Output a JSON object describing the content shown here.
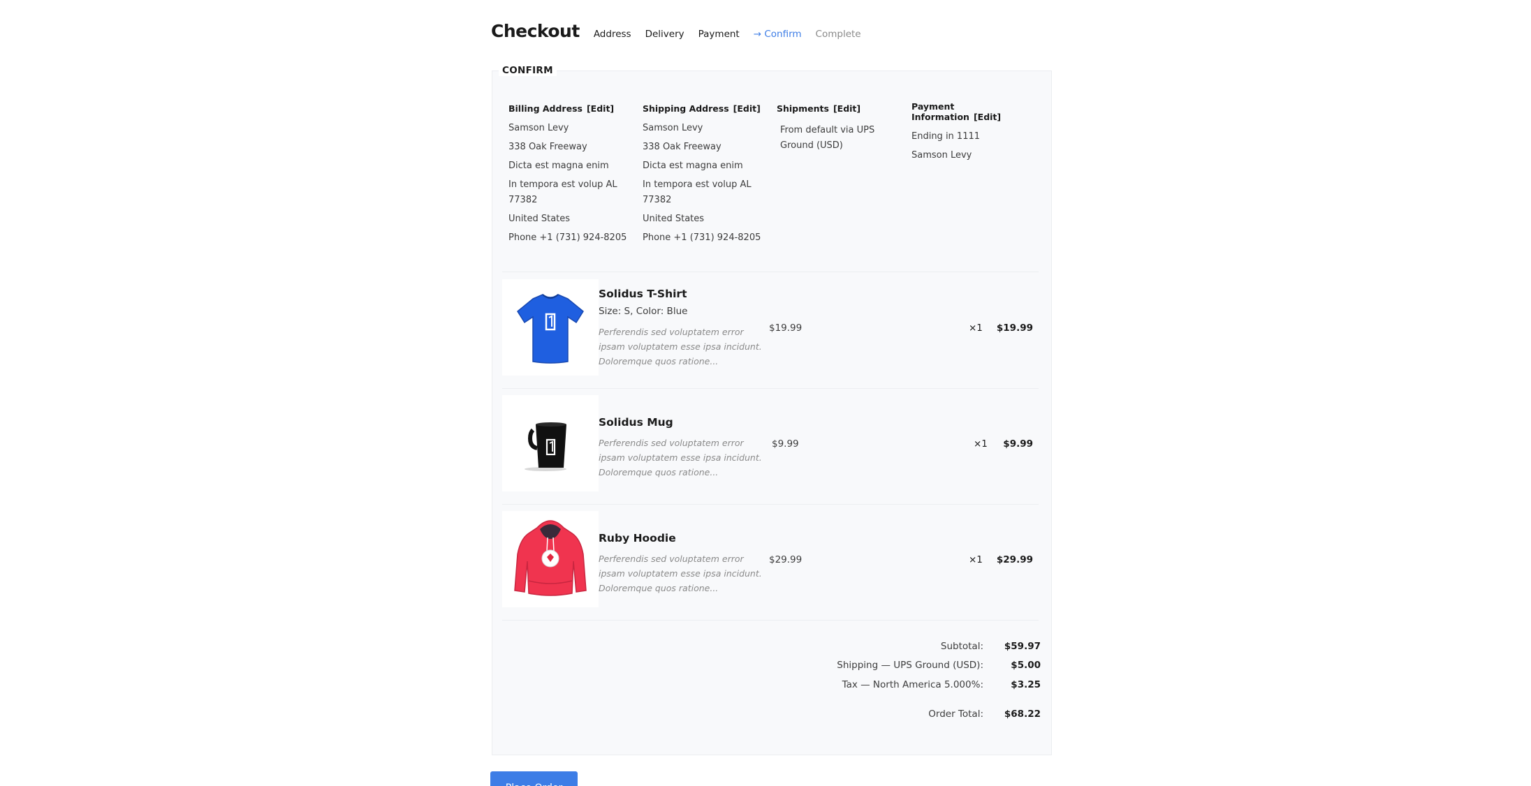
{
  "header": {
    "title": "Checkout",
    "steps": [
      {
        "label": "Address",
        "state": "done"
      },
      {
        "label": "Delivery",
        "state": "done"
      },
      {
        "label": "Payment",
        "state": "done"
      },
      {
        "label": "→ Confirm",
        "state": "current"
      },
      {
        "label": "Complete",
        "state": "future"
      }
    ]
  },
  "confirm": {
    "legend": "CONFIRM",
    "billing": {
      "heading": "Billing Address",
      "edit": "[Edit]",
      "lines": [
        "Samson Levy",
        "338 Oak Freeway",
        "Dicta est magna enim",
        "In tempora est volup AL",
        "77382",
        "United States",
        "Phone +1 (731) 924-8205"
      ]
    },
    "shipping": {
      "heading": "Shipping Address",
      "edit": "[Edit]",
      "lines": [
        "Samson Levy",
        "338 Oak Freeway",
        "Dicta est magna enim",
        "In tempora est volup AL",
        "77382",
        "United States",
        "Phone +1 (731) 924-8205"
      ]
    },
    "shipments": {
      "heading": "Shipments",
      "edit": "[Edit]",
      "lines": [
        "From default via UPS",
        "Ground (USD)"
      ]
    },
    "payment": {
      "heading": "Payment Information",
      "edit": "[Edit]",
      "lines": [
        "Ending in 1111",
        "Samson Levy"
      ]
    }
  },
  "items": [
    {
      "name": "Solidus T-Shirt",
      "variant": "Size: S, Color: Blue",
      "description": [
        "Perferendis sed voluptatem error",
        "ipsam voluptatem esse ipsa incidunt.",
        "Doloremque quos ratione..."
      ],
      "price": "$19.99",
      "qty": "×1",
      "total": "$19.99",
      "image": "blue-tshirt-image",
      "color": "#1f5fe0"
    },
    {
      "name": "Solidus Mug",
      "variant": "",
      "description": [
        "Perferendis sed voluptatem error",
        "ipsam voluptatem esse ipsa incidunt.",
        "Doloremque quos ratione..."
      ],
      "price": "$9.99",
      "qty": "×1",
      "total": "$9.99",
      "image": "black-mug-image",
      "color": "#111111"
    },
    {
      "name": "Ruby Hoodie",
      "variant": "",
      "description": [
        "Perferendis sed voluptatem error",
        "ipsam voluptatem esse ipsa incidunt.",
        "Doloremque quos ratione..."
      ],
      "price": "$29.99",
      "qty": "×1",
      "total": "$29.99",
      "image": "red-hoodie-image",
      "color": "#f0344f"
    }
  ],
  "totals": {
    "subtotal_label": "Subtotal:",
    "subtotal": "$59.97",
    "shipping_label": "Shipping — UPS Ground (USD):",
    "shipping": "$5.00",
    "tax_label": "Tax — North America 5.000%:",
    "tax": "$3.25",
    "order_total_label": "Order Total:",
    "order_total": "$68.22"
  },
  "actions": {
    "place_order": "Place Order"
  },
  "colors": {
    "accent": "#3d7de6",
    "panel_bg": "#f8f9fb"
  }
}
